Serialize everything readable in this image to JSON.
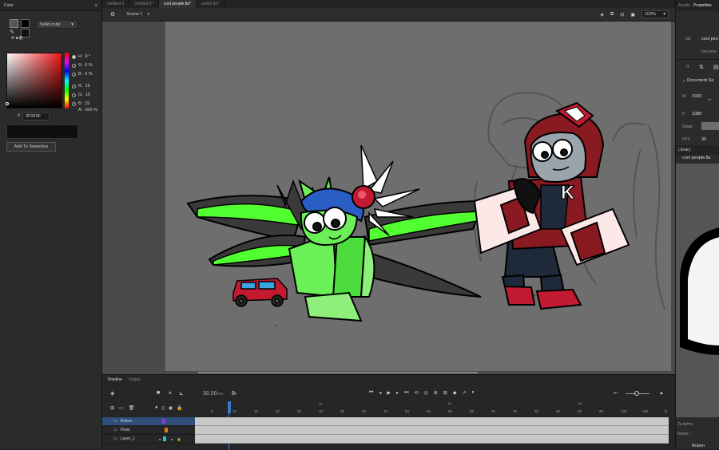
{
  "color_panel": {
    "title": "Color",
    "fill_type": "Solid color",
    "hsb": [
      {
        "label": "H:",
        "value": "0 °"
      },
      {
        "label": "S:",
        "value": "0 %"
      },
      {
        "label": "B:",
        "value": "6 %"
      }
    ],
    "rgb": [
      {
        "label": "R:",
        "value": "15"
      },
      {
        "label": "G:",
        "value": "15"
      },
      {
        "label": "B:",
        "value": "15"
      }
    ],
    "alpha_label": "A:",
    "alpha_value": "100 %",
    "hex_label": "#",
    "hex_value": "0F0F0F",
    "add_swatches": "Add To Swatches",
    "current_color": "#0f0f0f"
  },
  "document_tabs": [
    {
      "label": "Untitled-1",
      "active": false
    },
    {
      "label": "Untitled-2*",
      "active": false
    },
    {
      "label": "cool people.fla*",
      "active": true
    },
    {
      "label": "punks.fla*",
      "active": false
    }
  ],
  "scene_bar": {
    "scene": "Scene 1",
    "zoom": "102%"
  },
  "timeline": {
    "tabs": [
      "Timeline",
      "Output"
    ],
    "fps": "30.00",
    "fps_unit": "FPS",
    "current_frame": "9",
    "frame_unit": "F",
    "frame_numbers": [
      "5",
      "10",
      "15",
      "20",
      "25",
      "30",
      "35",
      "40",
      "45",
      "50",
      "55",
      "60",
      "65",
      "70",
      "75",
      "80",
      "85",
      "90",
      "95",
      "100",
      "105",
      "11"
    ],
    "time_markers": [
      "1s",
      "2s",
      "3s"
    ],
    "layers": [
      {
        "name": "Ruben",
        "selected": true,
        "color": "#8a3bd6"
      },
      {
        "name": "Pedo",
        "selected": false,
        "color": "#e07a14"
      },
      {
        "name": "Layer_1",
        "selected": false,
        "color": "#21c8d4"
      }
    ]
  },
  "right_panel": {
    "tabs": [
      "Assets",
      "Properties"
    ],
    "doc_name": "cool peo",
    "doc_type": "Docume",
    "section": "Document Se",
    "w_label": "W",
    "w_value": "1920",
    "h_label": "H",
    "h_value": "1080",
    "stage_label": "Stage",
    "fps_label": "FPS",
    "fps_value": "30",
    "library_title": "Library",
    "library_file": "cool people.fla",
    "items_count": "2a items",
    "name_header": "Name ↑",
    "item_name": "Ruben"
  }
}
